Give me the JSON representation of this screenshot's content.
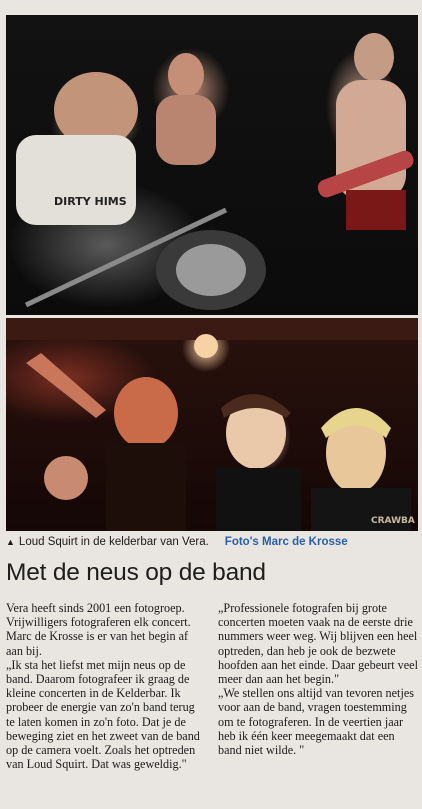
{
  "photos": {
    "top": {
      "subject": "Band playing on stage",
      "shirt_text": "DIRTY HIMS"
    },
    "bottom": {
      "subject": "Crowd in the kelderbar",
      "shirt_text": "CRAWBA"
    }
  },
  "caption": {
    "marker": "▲",
    "text": "Loud Squirt in de kelderbar van Vera.",
    "credit": "Foto's Marc de Krosse",
    "credit_color": "#2a5fa8"
  },
  "headline": "Met de neus op de band",
  "article": {
    "left": [
      "Vera heeft sinds 2001 een fotogroep. Vrijwilligers fotograferen elk concert. Marc de Krosse is er van het begin af aan bij.",
      "„Ik sta het liefst met mijn neus op de band. Daarom fotografeer ik graag de kleine concerten in de Kelderbar. Ik probeer de energie van zo'n band terug te laten komen in zo'n foto. Dat je de beweging ziet en het zweet van de band op de camera voelt. Zoals het optreden van Loud Squirt. Dat was geweldig.\""
    ],
    "right": [
      "„Professionele fotografen bij grote concerten moeten vaak na de eerste drie nummers weer weg. Wij blijven een heel optreden, dan heb je ook de bezwete hoofden aan het einde. Daar gebeurt veel meer dan aan het begin.\"",
      "„We stellen ons altijd van tevoren netjes voor aan de band, vragen toestemming om te fotograferen. In de veertien jaar heb ik één keer meegemaakt dat een band niet wilde. \""
    ]
  }
}
